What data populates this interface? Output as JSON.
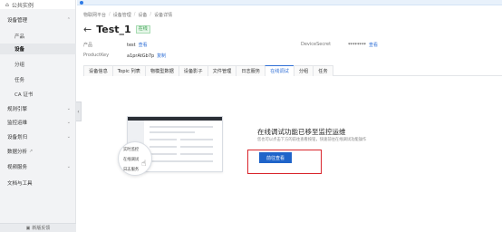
{
  "sidebar": {
    "top_label": "公共实例",
    "items": [
      {
        "label": "设备管理",
        "type": "section",
        "chevron": "up"
      },
      {
        "label": "产品",
        "type": "child"
      },
      {
        "label": "设备",
        "type": "child",
        "active": true
      },
      {
        "label": "分组",
        "type": "child"
      },
      {
        "label": "任务",
        "type": "child"
      },
      {
        "label": "CA 证书",
        "type": "child"
      },
      {
        "label": "规则引擎",
        "type": "section",
        "chevron": "down"
      },
      {
        "label": "监控运维",
        "type": "section",
        "chevron": "down"
      },
      {
        "label": "设备划归",
        "type": "section",
        "chevron": "down"
      },
      {
        "label": "数据分析",
        "type": "section"
      },
      {
        "label": "视频服务",
        "type": "section",
        "chevron": "down"
      },
      {
        "label": "文档与工具",
        "type": "section"
      }
    ],
    "bottom_label": "新版反馈"
  },
  "breadcrumb": [
    "物联网平台",
    "设备管理",
    "设备",
    "设备详情"
  ],
  "device": {
    "name": "Test_1",
    "status": "在线"
  },
  "meta": {
    "product_label": "产品",
    "product_value": "test",
    "product_link": "查看",
    "productkey_label": "ProductKey",
    "productkey_value": "a1prAtGb7p",
    "productkey_link": "复制",
    "devicesecret_label": "DeviceSecret",
    "devicesecret_value": "********",
    "devicesecret_link": "查看"
  },
  "tabs": [
    {
      "label": "设备信息"
    },
    {
      "label": "Topic 列表"
    },
    {
      "label": "物模型数据"
    },
    {
      "label": "设备影子"
    },
    {
      "label": "文件管理"
    },
    {
      "label": "日志服务"
    },
    {
      "label": "在线调试",
      "active": true
    },
    {
      "label": "分组"
    },
    {
      "label": "任务"
    }
  ],
  "online_debug": {
    "title": "在线调试功能已移至监控运维",
    "description": "您也可以点击下方的前往查看按钮，快速前往在线调试功能操作",
    "button_label": "前往查看",
    "illustration_options": [
      "实时监控",
      "在线调试",
      "日志服务"
    ]
  },
  "colors": {
    "accent": "#2f6fd6",
    "primary_button": "#1f64c9",
    "highlight_box": "#d9252c",
    "status_green": "#2f9a47"
  }
}
